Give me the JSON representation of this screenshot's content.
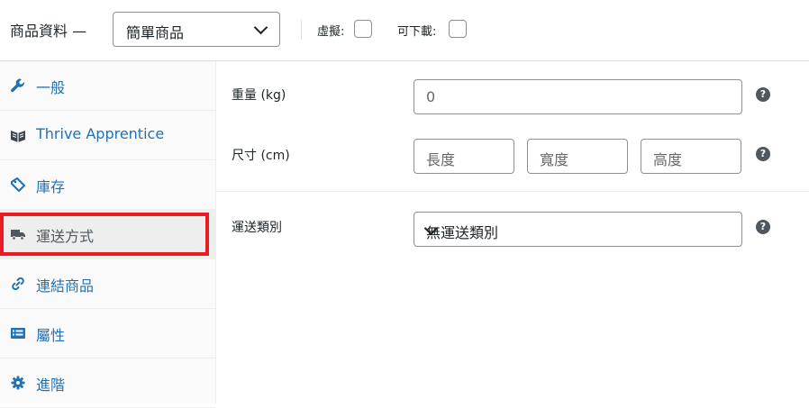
{
  "header": {
    "title": "商品資料 —",
    "product_type": "簡單商品",
    "virtual_label": "虛擬:",
    "downloadable_label": "可下載:"
  },
  "sidebar": {
    "items": [
      {
        "label": "一般",
        "icon": "wrench-icon"
      },
      {
        "label": "Thrive Apprentice",
        "icon": "book-icon"
      },
      {
        "label": "庫存",
        "icon": "tag-icon"
      },
      {
        "label": "運送方式",
        "icon": "truck-icon",
        "active": true
      },
      {
        "label": "連結商品",
        "icon": "link-icon"
      },
      {
        "label": "屬性",
        "icon": "list-icon"
      },
      {
        "label": "進階",
        "icon": "gear-icon"
      }
    ]
  },
  "shipping": {
    "weight_label": "重量 (kg)",
    "weight_placeholder": "0",
    "dimensions_label": "尺寸 (cm)",
    "length_placeholder": "長度",
    "width_placeholder": "寬度",
    "height_placeholder": "高度",
    "class_label": "運送類別",
    "class_value": "無運送類別",
    "help_glyph": "?"
  },
  "colors": {
    "link": "#2271b1",
    "highlight": "#e81c24",
    "active_bg": "#eeeeee"
  }
}
